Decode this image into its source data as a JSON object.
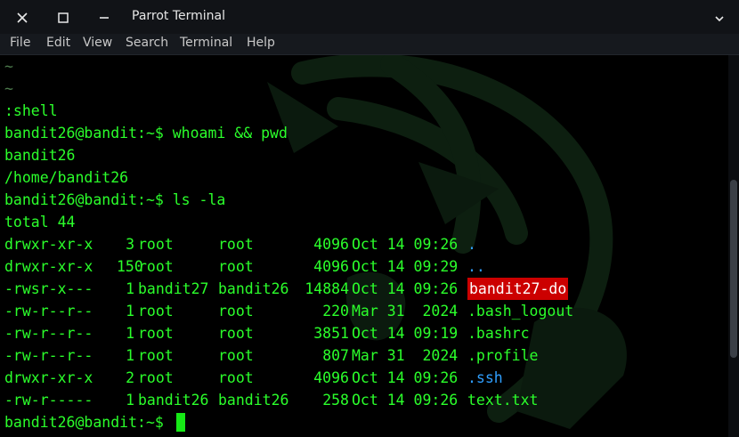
{
  "window": {
    "title": "Parrot Terminal"
  },
  "icons": {
    "close": "close-icon",
    "maximize": "maximize-icon",
    "minimize": "minimize-icon",
    "menu": "chevron-down-icon"
  },
  "menu": [
    "File",
    "Edit",
    "View",
    "Search",
    "Terminal",
    "Help"
  ],
  "terminal": {
    "tilde1": "~",
    "tilde2": "~",
    "shell": ":shell",
    "prompt1": "bandit26@bandit:~$ whoami && pwd",
    "out_user": "bandit26",
    "out_pwd": "/home/bandit26",
    "prompt2": "bandit26@bandit:~$ ls -la",
    "total": "total 44",
    "listing": [
      {
        "perms": "drwxr-xr-x",
        "links": "3",
        "owner": "root",
        "group": "root",
        "size": "4096",
        "date": "Oct 14 09:26",
        "name": "."
      },
      {
        "perms": "drwxr-xr-x",
        "links": "150",
        "owner": "root",
        "group": "root",
        "size": "4096",
        "date": "Oct 14 09:29",
        "name": ".."
      },
      {
        "perms": "-rwsr-x---",
        "links": "1",
        "owner": "bandit27",
        "group": "bandit26",
        "size": "14884",
        "date": "Oct 14 09:26",
        "name": "bandit27-do"
      },
      {
        "perms": "-rw-r--r--",
        "links": "1",
        "owner": "root",
        "group": "root",
        "size": "220",
        "date": "Mar 31  2024",
        "name": ".bash_logout"
      },
      {
        "perms": "-rw-r--r--",
        "links": "1",
        "owner": "root",
        "group": "root",
        "size": "3851",
        "date": "Oct 14 09:19",
        "name": ".bashrc"
      },
      {
        "perms": "-rw-r--r--",
        "links": "1",
        "owner": "root",
        "group": "root",
        "size": "807",
        "date": "Mar 31  2024",
        "name": ".profile"
      },
      {
        "perms": "drwxr-xr-x",
        "links": "2",
        "owner": "root",
        "group": "root",
        "size": "4096",
        "date": "Oct 14 09:26",
        "name": ".ssh"
      },
      {
        "perms": "-rw-r-----",
        "links": "1",
        "owner": "bandit26",
        "group": "bandit26",
        "size": "258",
        "date": "Oct 14 09:26",
        "name": "text.txt"
      }
    ],
    "prompt3": "bandit26@bandit:~$ "
  },
  "colors": {
    "text": "#2bff2b",
    "directory": "#2f9fff",
    "suid_bg": "#cc0000",
    "cursor": "#16e916",
    "background": "#000000"
  }
}
